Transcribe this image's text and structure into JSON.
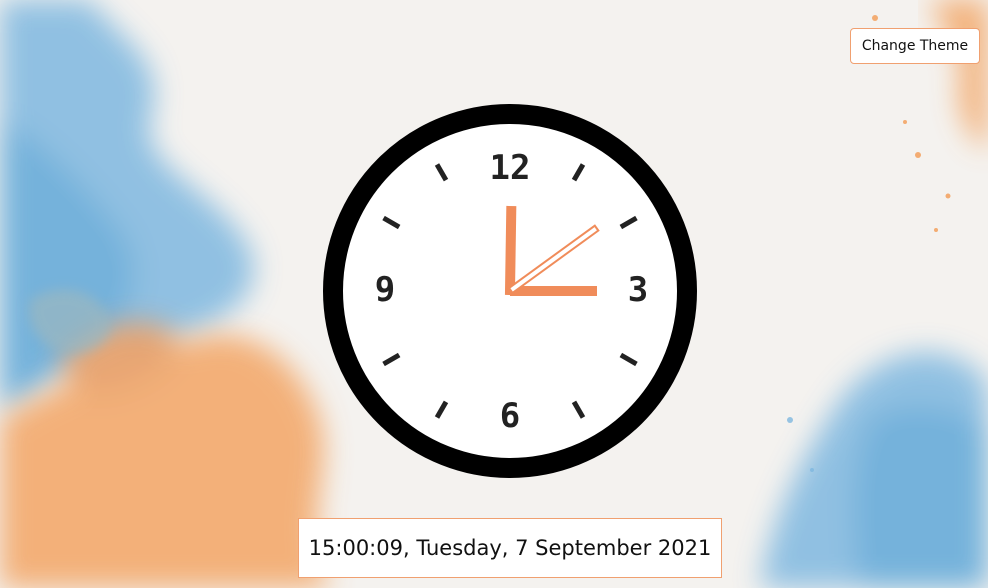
{
  "theme_button": {
    "label": "Change Theme"
  },
  "clock": {
    "numerals": {
      "n12": "12",
      "n3": "3",
      "n6": "6",
      "n9": "9"
    },
    "time": {
      "hours": 15,
      "minutes": 0,
      "seconds": 9
    },
    "colors": {
      "hand": "#f08c5a",
      "rim": "#000000",
      "tick": "#222222"
    }
  },
  "datetime": {
    "text": "15:00:09, Tuesday, 7 September 2021"
  },
  "colors": {
    "accent": "#f0a070",
    "blue_wash": "#8fc3e6",
    "orange_wash": "#f5b27a"
  }
}
